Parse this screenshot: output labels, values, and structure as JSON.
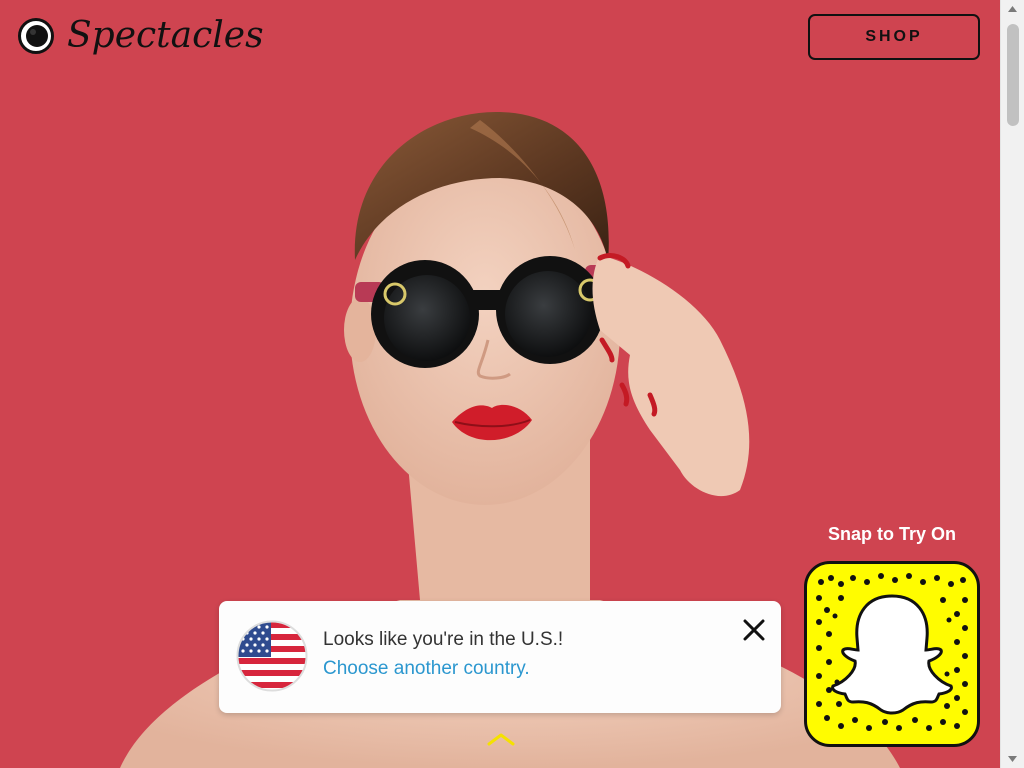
{
  "header": {
    "brand": "Spectacles",
    "shop_label": "SHOP"
  },
  "snapcode": {
    "caption": "Snap to Try On"
  },
  "location_toast": {
    "message": "Looks like you're in the U.S.!",
    "link": "Choose another country."
  },
  "colors": {
    "background": "#cf4450",
    "snapcode_yellow": "#fffc00",
    "link_blue": "#2b97cf",
    "chevron": "#f5e100"
  },
  "icons": {
    "logo": "spectacles-camera-ring-icon",
    "flag": "us-flag-icon",
    "close": "close-icon",
    "chevron": "chevron-up-icon",
    "snapcode": "snapchat-ghost-icon"
  }
}
